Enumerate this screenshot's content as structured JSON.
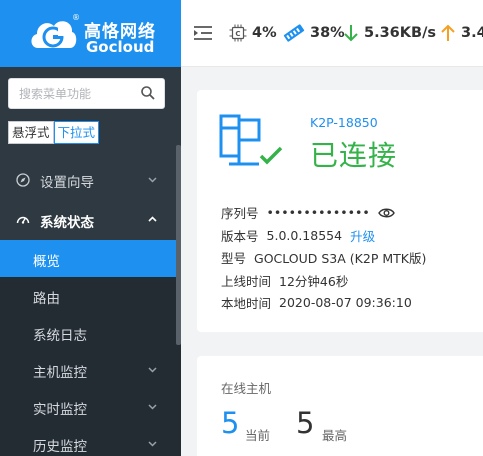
{
  "brand": {
    "name_cn": "高恪网络",
    "name_en": "Gocloud",
    "reg_mark": "®"
  },
  "sidebar": {
    "search_placeholder": "搜索菜单功能",
    "modes": [
      "悬浮式",
      "下拉式"
    ],
    "active_mode": "下拉式",
    "menu": [
      {
        "label": "设置向导",
        "icon": "compass-icon",
        "expanded": false
      },
      {
        "label": "系统状态",
        "icon": "dashboard-icon",
        "expanded": true
      }
    ],
    "submenu": [
      {
        "label": "概览",
        "active": true,
        "has_children": false
      },
      {
        "label": "路由",
        "active": false,
        "has_children": false
      },
      {
        "label": "系统日志",
        "active": false,
        "has_children": false
      },
      {
        "label": "主机监控",
        "active": false,
        "has_children": true
      },
      {
        "label": "实时监控",
        "active": false,
        "has_children": true
      },
      {
        "label": "历史监控",
        "active": false,
        "has_children": true
      }
    ]
  },
  "topbar": {
    "cpu": "4%",
    "memory": "38%",
    "download": "5.36KB/s",
    "upload": "3.4"
  },
  "device": {
    "name": "K2P-18850",
    "status": "已连接",
    "serial_label": "序列号",
    "serial_value": "••••••••••••••",
    "version_label": "版本号",
    "version_value": "5.0.0.18554",
    "upgrade_label": "升级",
    "model_label": "型号",
    "model_value": "GOCLOUD S3A (K2P MTK版)",
    "uptime_label": "上线时间",
    "uptime_value": "12分钟46秒",
    "localtime_label": "本地时间",
    "localtime_value": "2020-08-07 09:36:10"
  },
  "hosts": {
    "title": "在线主机",
    "current_value": "5",
    "current_label": "当前",
    "max_value": "5",
    "max_label": "最高"
  },
  "colors": {
    "brand_blue": "#1e90f0",
    "sidebar_bg": "#2f3942",
    "connected_green": "#35b34a",
    "download_green": "#35b34a",
    "upload_orange": "#f5a023"
  }
}
